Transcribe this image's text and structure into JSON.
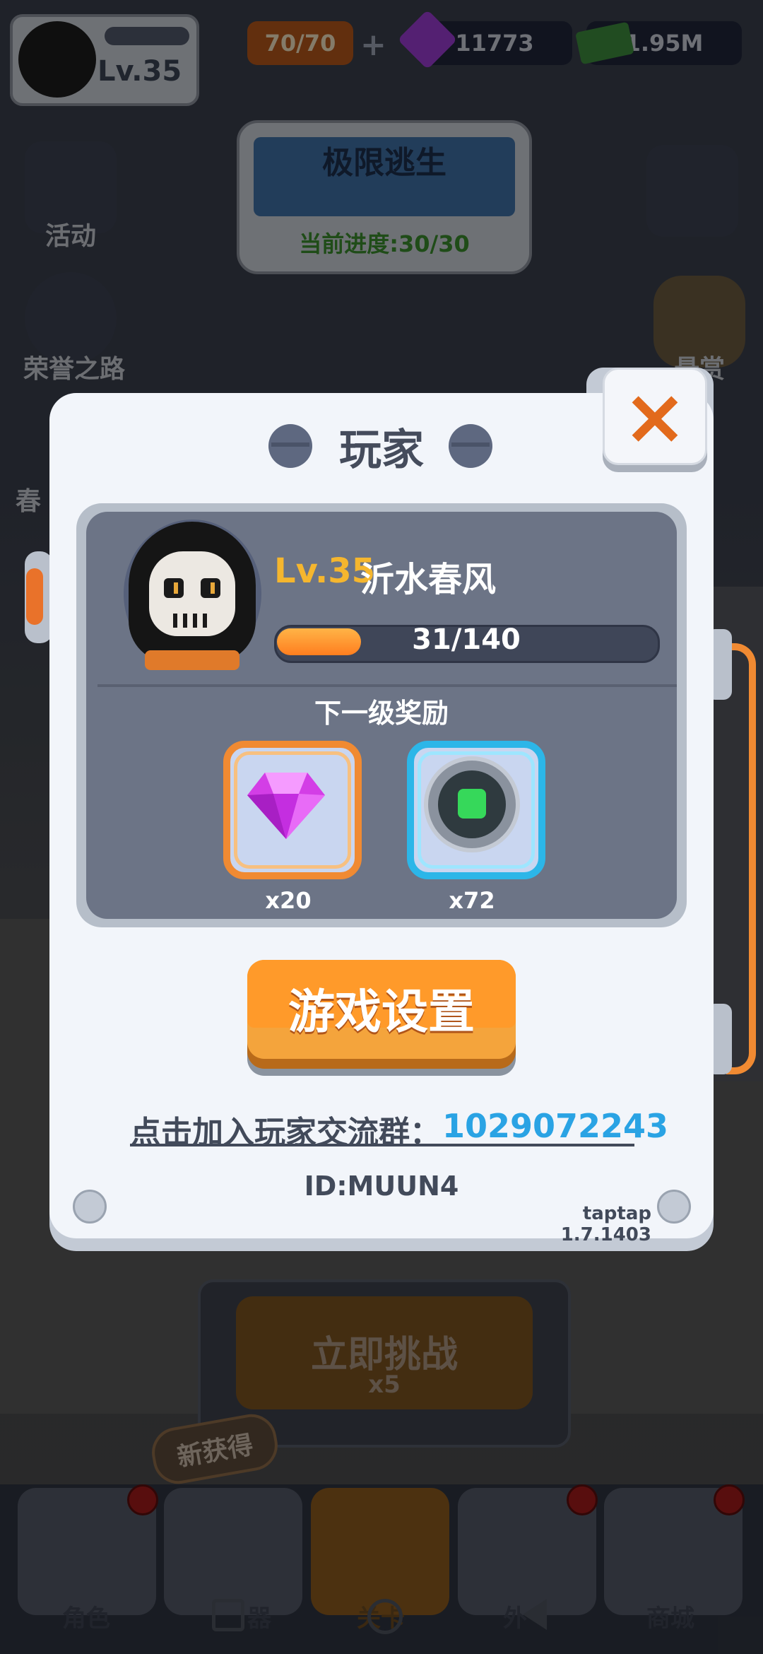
{
  "hud": {
    "level": "Lv.35",
    "energy": "70/70",
    "gems": "11773",
    "cash": "1.95M",
    "side_left": [
      "活动",
      "荣誉之路",
      "春"
    ],
    "side_right": [
      "悬赏"
    ],
    "map": {
      "title": "极限逃生",
      "progress": "当前进度:30/30"
    },
    "challenge": {
      "label": "立即挑战",
      "cost": "x5"
    },
    "new_tag": "新获得",
    "tabs": [
      "角色",
      "器",
      "关卡",
      "外",
      "商城"
    ]
  },
  "modal": {
    "title": "玩家",
    "close_icon": "×",
    "player": {
      "level": "Lv.35",
      "name": "沂水春风",
      "xp_text": "31/140",
      "xp_current": 31,
      "xp_max": 140
    },
    "next_reward_title": "下一级奖励",
    "rewards": [
      {
        "icon": "purple-gem-icon",
        "qty": "x20"
      },
      {
        "icon": "green-fist-coin-icon",
        "qty": "x72"
      }
    ],
    "settings_button": "游戏设置",
    "join_label": "点击加入玩家交流群：",
    "join_number": "1029072243",
    "player_id": "ID:MUUN4",
    "version": "taptap 1.7.1403"
  },
  "colors": {
    "accent_orange": "#ff9a2a",
    "gold": "#f5b62e",
    "link_blue": "#2aa3e4",
    "panel": "#6c7486"
  }
}
